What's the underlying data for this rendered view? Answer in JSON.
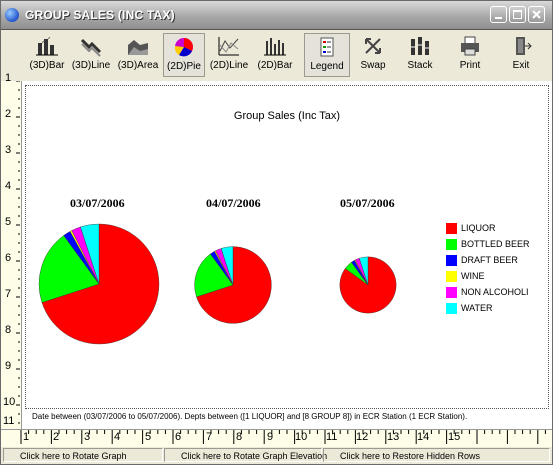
{
  "window": {
    "title": "GROUP SALES (INC TAX)"
  },
  "toolbar": {
    "buttons": [
      {
        "label": "(3D)Bar",
        "icon": "3d-bar-chart-icon"
      },
      {
        "label": "(3D)Line",
        "icon": "3d-line-chart-icon"
      },
      {
        "label": "(3D)Area",
        "icon": "3d-area-chart-icon"
      },
      {
        "label": "(2D)Pie",
        "icon": "2d-pie-chart-icon"
      },
      {
        "label": "(2D)Line",
        "icon": "2d-line-chart-icon"
      },
      {
        "label": "(2D)Bar",
        "icon": "2d-bar-chart-icon"
      },
      {
        "label": "Legend",
        "icon": "legend-icon"
      },
      {
        "label": "Swap",
        "icon": "swap-icon"
      },
      {
        "label": "Stack",
        "icon": "stack-icon"
      },
      {
        "label": "Print",
        "icon": "printer-icon"
      },
      {
        "label": "Exit",
        "icon": "exit-door-icon"
      }
    ],
    "active": [
      "(2D)Pie",
      "Legend"
    ]
  },
  "ruler": {
    "left": [
      "1",
      "2",
      "3",
      "4",
      "5",
      "6",
      "7",
      "8",
      "9",
      "10",
      "11"
    ],
    "bottom": [
      "1",
      "2",
      "3",
      "4",
      "5",
      "6",
      "7",
      "8",
      "9",
      "10",
      "11",
      "12",
      "13",
      "14",
      "15"
    ]
  },
  "colors": {
    "liquor": "#ff0000",
    "bottled_beer": "#00ff00",
    "draft_beer": "#0000ff",
    "wine": "#ffff00",
    "non_alcoholic": "#ff00ff",
    "water": "#00ffff"
  },
  "chart_data": {
    "type": "pie",
    "title": "Group Sales (Inc Tax)",
    "legend_position": "right",
    "categories": [
      "LIQUOR",
      "BOTTLED BEER",
      "DRAFT BEER",
      "WINE",
      "NON ALCOHOLI",
      "WATER"
    ],
    "series": [
      {
        "name": "03/07/2006",
        "values": [
          70,
          20,
          2,
          0.5,
          2.5,
          5
        ]
      },
      {
        "name": "04/07/2006",
        "values": [
          70,
          20,
          2,
          0.5,
          2.5,
          5
        ]
      },
      {
        "name": "05/07/2006",
        "values": [
          85,
          5,
          2,
          0.5,
          2.5,
          5
        ]
      }
    ],
    "relative_totals": [
      1.0,
      0.41,
      0.22
    ]
  },
  "footer": "Date between   (03/07/2006 to 05/07/2006). Depts between ([1    LIQUOR] and [8    GROUP 8]) in ECR Station (1    ECR Station).",
  "status": [
    "Click here to Rotate Graph",
    "Click here to Rotate Graph Elevation",
    "Click here to Restore Hidden Rows"
  ]
}
